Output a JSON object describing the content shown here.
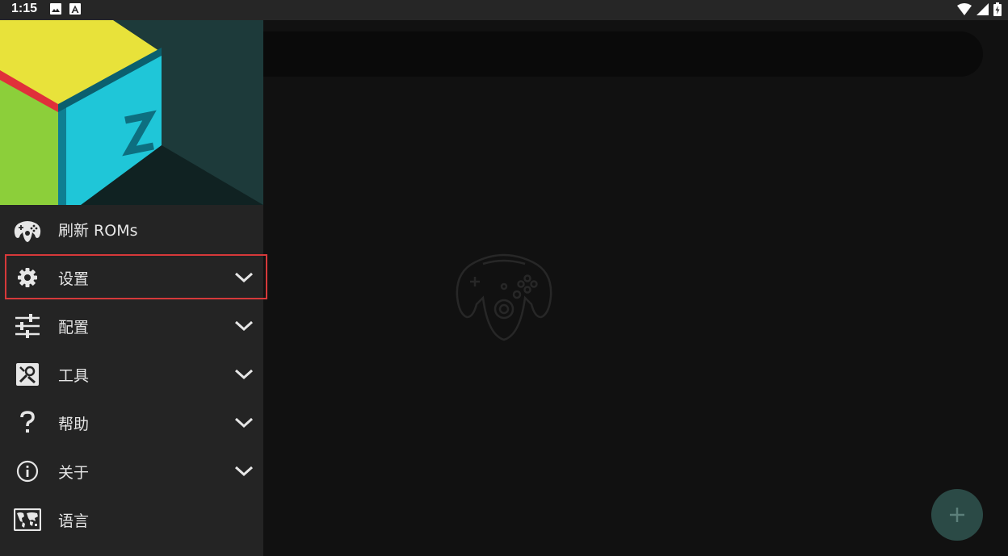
{
  "status_bar": {
    "time": "1:15",
    "left_icons": [
      "image-icon",
      "a-badge-icon"
    ],
    "right_icons": [
      "wifi-icon",
      "signal-icon",
      "battery-icon"
    ]
  },
  "drawer": {
    "header_logo": "mupen64plus-cube-logo",
    "items": [
      {
        "label": "刷新 ROMs",
        "icon": "controller-icon",
        "expandable": false
      },
      {
        "label": "设置",
        "icon": "gear-icon",
        "expandable": true,
        "highlighted": true
      },
      {
        "label": "配置",
        "icon": "sliders-icon",
        "expandable": true
      },
      {
        "label": "工具",
        "icon": "tools-icon",
        "expandable": true
      },
      {
        "label": "帮助",
        "icon": "question-icon",
        "expandable": true
      },
      {
        "label": "关于",
        "icon": "info-icon",
        "expandable": true
      },
      {
        "label": "语言",
        "icon": "world-map-icon",
        "expandable": false
      }
    ]
  },
  "main": {
    "empty_state_icon": "n64-controller-icon",
    "fab_icon": "plus-icon"
  },
  "colors": {
    "status_bar_bg": "#262626",
    "drawer_bg": "#242424",
    "main_bg": "#111111",
    "highlight_border": "#d6393a",
    "fab_bg": "#2b4a46",
    "cube_yellow": "#e8e23a",
    "cube_cyan": "#1fc6d8",
    "cube_green": "#8ccf3a",
    "cube_red_edge": "#e0303a"
  }
}
